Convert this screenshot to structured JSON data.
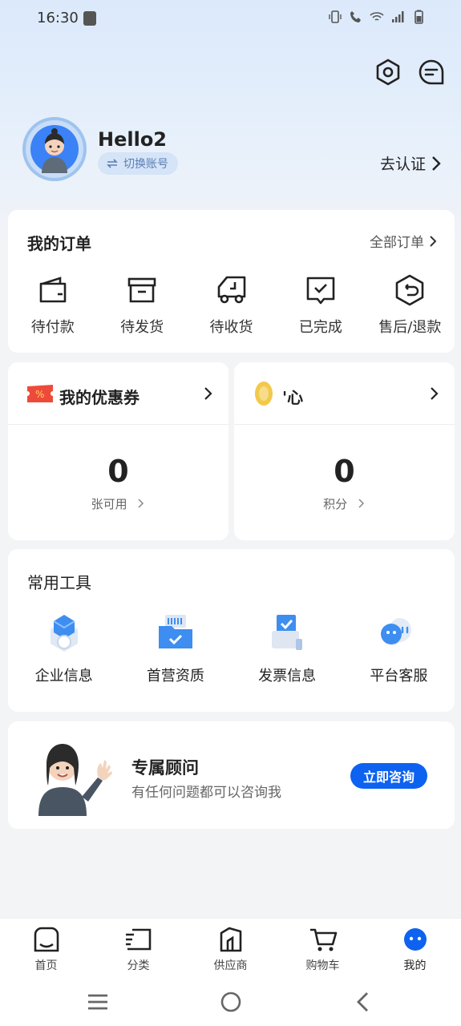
{
  "status_bar": {
    "time": "16:30"
  },
  "profile": {
    "username": "Hello2",
    "switch_account": "切换账号",
    "verify": "去认证"
  },
  "orders": {
    "title": "我的订单",
    "all_orders": "全部订单",
    "items": [
      {
        "label": "待付款",
        "icon": "wallet-icon"
      },
      {
        "label": "待发货",
        "icon": "box-icon"
      },
      {
        "label": "待收货",
        "icon": "truck-icon"
      },
      {
        "label": "已完成",
        "icon": "check-message-icon"
      },
      {
        "label": "售后/退款",
        "icon": "refund-icon"
      }
    ]
  },
  "coupons": {
    "title": "我的优惠券",
    "value": "0",
    "sub": "张可用"
  },
  "points": {
    "title": "'心",
    "value": "0",
    "sub": "积分"
  },
  "tools": {
    "title": "常用工具",
    "items": [
      {
        "label": "企业信息",
        "icon": "enterprise-icon"
      },
      {
        "label": "首营资质",
        "icon": "qualification-icon"
      },
      {
        "label": "发票信息",
        "icon": "invoice-icon"
      },
      {
        "label": "平台客服",
        "icon": "customer-service-icon"
      }
    ]
  },
  "advisor": {
    "title": "专属顾问",
    "subtitle": "有任何问题都可以咨询我",
    "button": "立即咨询"
  },
  "bottom_nav": {
    "items": [
      {
        "label": "首页",
        "icon": "home-icon"
      },
      {
        "label": "分类",
        "icon": "category-icon"
      },
      {
        "label": "供应商",
        "icon": "supplier-icon"
      },
      {
        "label": "购物车",
        "icon": "cart-icon"
      },
      {
        "label": "我的",
        "icon": "profile-icon"
      }
    ],
    "active": "我的"
  },
  "colors": {
    "accent": "#0d62f0",
    "background": "#f3f4f6"
  }
}
